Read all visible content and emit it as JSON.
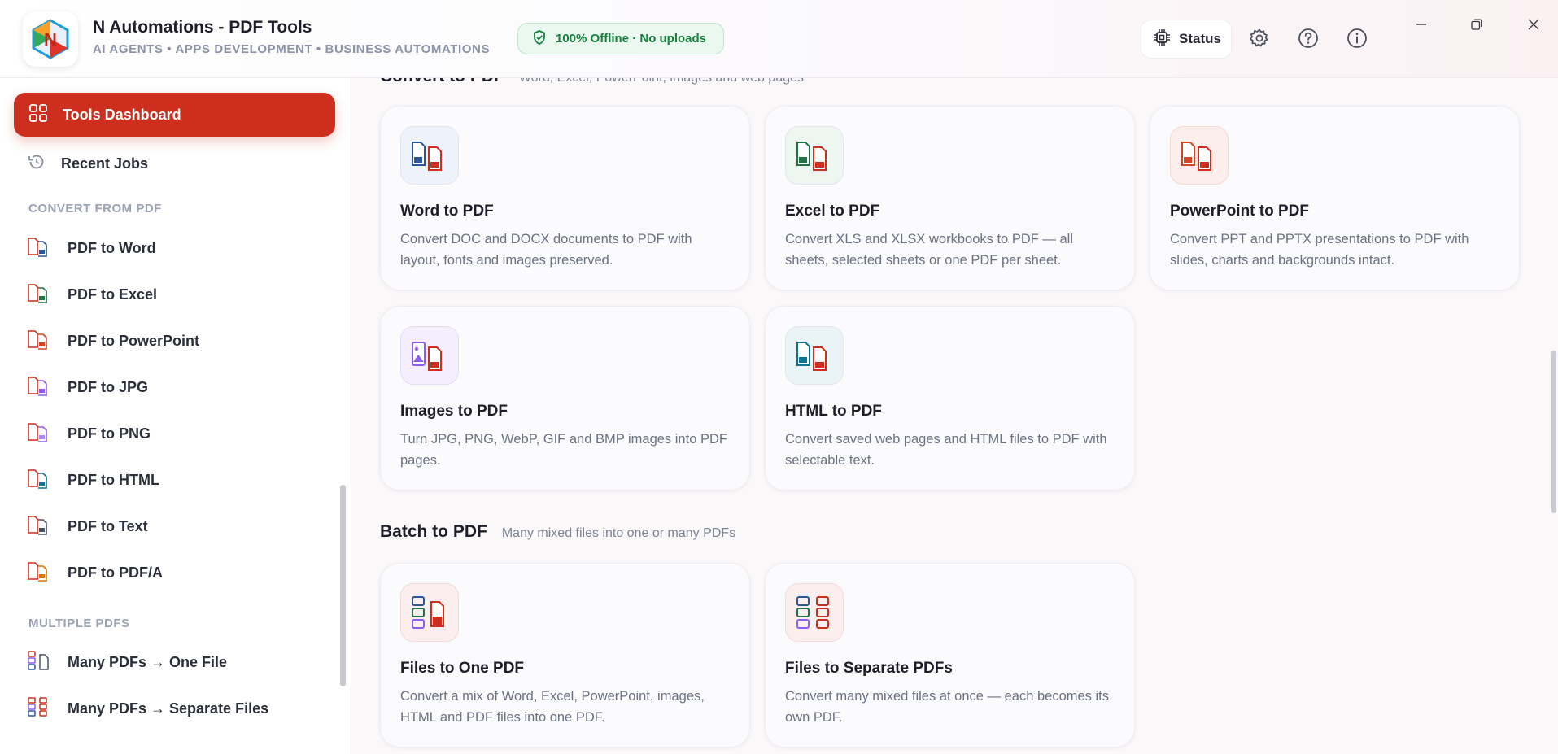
{
  "app": {
    "title": "N Automations - PDF Tools",
    "subtitle": "AI AGENTS • APPS DEVELOPMENT • BUSINESS AUTOMATIONS",
    "logo_letter": "N",
    "offline_badge": "100% Offline · No uploads",
    "status_label": "Status"
  },
  "colors": {
    "accent": "#cd2e1d",
    "offline_green": "#14803d",
    "word_blue": "#2b579a",
    "excel_green": "#217346",
    "ppt_red": "#d24726",
    "image_purple": "#8b5cf6",
    "html_teal": "#0e7490"
  },
  "sidebar": {
    "active_item": {
      "label": "Tools Dashboard",
      "icon": "grid-icon"
    },
    "recent": {
      "label": "Recent Jobs",
      "icon": "history-icon"
    },
    "section_convert_from": "CONVERT FROM PDF",
    "convert_from_items": [
      {
        "label": "PDF to Word",
        "icon": "pdf-to-word-icon"
      },
      {
        "label": "PDF to Excel",
        "icon": "pdf-to-excel-icon"
      },
      {
        "label": "PDF to PowerPoint",
        "icon": "pdf-to-powerpoint-icon"
      },
      {
        "label": "PDF to JPG",
        "icon": "pdf-to-jpg-icon"
      },
      {
        "label": "PDF to PNG",
        "icon": "pdf-to-png-icon"
      },
      {
        "label": "PDF to HTML",
        "icon": "pdf-to-html-icon"
      },
      {
        "label": "PDF to Text",
        "icon": "pdf-to-text-icon"
      },
      {
        "label": "PDF to PDF/A",
        "icon": "pdf-to-pdfa-icon"
      }
    ],
    "section_multiple": "MULTIPLE PDFS",
    "multiple_items": [
      {
        "label": "Many PDFs → One File",
        "icon": "merge-pdfs-icon"
      },
      {
        "label": "Many PDFs → Separate Files",
        "icon": "split-pdfs-icon"
      }
    ]
  },
  "main": {
    "convert_to": {
      "title": "Convert to PDF",
      "desc": "Word, Excel, PowerPoint, images and web pages",
      "cards": [
        {
          "title": "Word to PDF",
          "desc": "Convert DOC and DOCX documents to PDF with layout, fonts and images preserved.",
          "icon": "word-to-pdf-icon"
        },
        {
          "title": "Excel to PDF",
          "desc": "Convert XLS and XLSX workbooks to PDF — all sheets, selected sheets or one PDF per sheet.",
          "icon": "excel-to-pdf-icon"
        },
        {
          "title": "PowerPoint to PDF",
          "desc": "Convert PPT and PPTX presentations to PDF with slides, charts and backgrounds intact.",
          "icon": "powerpoint-to-pdf-icon"
        },
        {
          "title": "Images to PDF",
          "desc": "Turn JPG, PNG, WebP, GIF and BMP images into PDF pages.",
          "icon": "images-to-pdf-icon"
        },
        {
          "title": "HTML to PDF",
          "desc": "Convert saved web pages and HTML files to PDF with selectable text.",
          "icon": "html-to-pdf-icon"
        }
      ]
    },
    "batch": {
      "title": "Batch to PDF",
      "desc": "Many mixed files into one or many PDFs",
      "cards": [
        {
          "title": "Files to One PDF",
          "desc": "Convert a mix of Word, Excel, PowerPoint, images, HTML and PDF files into one PDF.",
          "icon": "files-to-one-pdf-icon"
        },
        {
          "title": "Files to Separate PDFs",
          "desc": "Convert many mixed files at once — each becomes its own PDF.",
          "icon": "files-to-separate-pdfs-icon"
        }
      ]
    }
  }
}
